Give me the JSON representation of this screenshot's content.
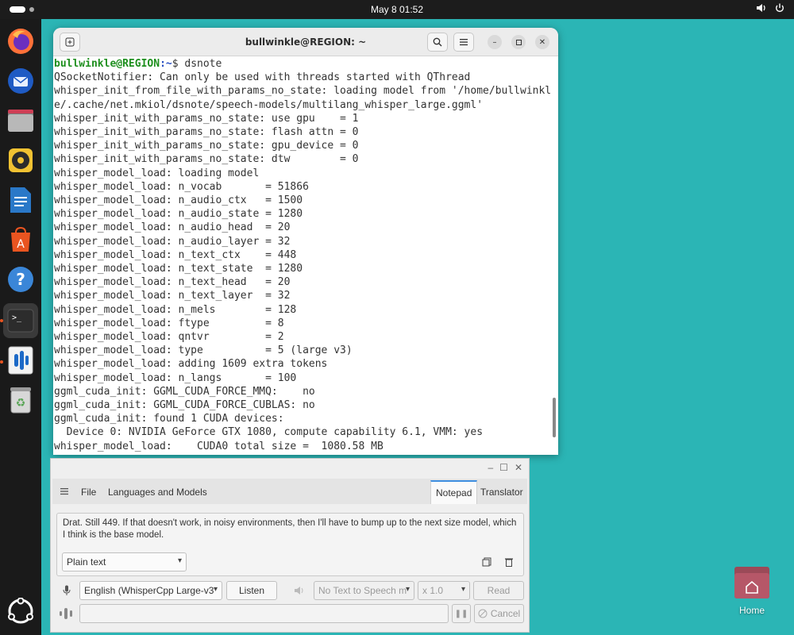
{
  "topbar": {
    "clock": "May 8  01:52"
  },
  "dock": {
    "items": [
      {
        "name": "firefox-icon",
        "color": "#ff7139"
      },
      {
        "name": "thunderbird-icon",
        "color": "#2f6fd6"
      },
      {
        "name": "files-icon",
        "color": "#cf3f56"
      },
      {
        "name": "rhythmbox-icon",
        "color": "#f1c232"
      },
      {
        "name": "libreoffice-writer-icon",
        "color": "#2a78c8"
      },
      {
        "name": "app-center-icon",
        "color": "#e95420"
      },
      {
        "name": "help-icon",
        "color": "#3a86d8"
      },
      {
        "name": "terminal-icon",
        "color": "#333333"
      },
      {
        "name": "dsnote-icon",
        "color": "#1c69c7"
      },
      {
        "name": "trash-icon",
        "color": "#59a556"
      }
    ]
  },
  "terminal": {
    "title": "bullwinkle@REGION: ~",
    "prompt_user": "bullwinkle@REGION",
    "prompt_path": ":~",
    "prompt_cmd": "$ dsnote",
    "lines": [
      "QSocketNotifier: Can only be used with threads started with QThread",
      "whisper_init_from_file_with_params_no_state: loading model from '/home/bullwinkl",
      "e/.cache/net.mkiol/dsnote/speech-models/multilang_whisper_large.ggml'",
      "whisper_init_with_params_no_state: use gpu    = 1",
      "whisper_init_with_params_no_state: flash attn = 0",
      "whisper_init_with_params_no_state: gpu_device = 0",
      "whisper_init_with_params_no_state: dtw        = 0",
      "whisper_model_load: loading model",
      "whisper_model_load: n_vocab       = 51866",
      "whisper_model_load: n_audio_ctx   = 1500",
      "whisper_model_load: n_audio_state = 1280",
      "whisper_model_load: n_audio_head  = 20",
      "whisper_model_load: n_audio_layer = 32",
      "whisper_model_load: n_text_ctx    = 448",
      "whisper_model_load: n_text_state  = 1280",
      "whisper_model_load: n_text_head   = 20",
      "whisper_model_load: n_text_layer  = 32",
      "whisper_model_load: n_mels        = 128",
      "whisper_model_load: ftype         = 8",
      "whisper_model_load: qntvr         = 2",
      "whisper_model_load: type          = 5 (large v3)",
      "whisper_model_load: adding 1609 extra tokens",
      "whisper_model_load: n_langs       = 100",
      "ggml_cuda_init: GGML_CUDA_FORCE_MMQ:    no",
      "ggml_cuda_init: GGML_CUDA_FORCE_CUBLAS: no",
      "ggml_cuda_init: found 1 CUDA devices:",
      "  Device 0: NVIDIA GeForce GTX 1080, compute capability 6.1, VMM: yes",
      "whisper_model_load:    CUDA0 total size =  1080.58 MB"
    ]
  },
  "dsnote": {
    "menu": {
      "file": "File",
      "languages_models": "Languages and Models"
    },
    "tabs": {
      "notepad": "Notepad",
      "translator": "Translator"
    },
    "note_text": "Drat. Still 449. If that doesn't work, in noisy environments, then I'll have to bump up to the next size model, which I think is the base model.",
    "text_format": "Plain text",
    "stt_model": "English (WhisperCpp Large-v3",
    "listen_label": "Listen",
    "tts_model": "No Text to Speech m",
    "speed": "x 1.0",
    "read_label": "Read",
    "cancel_label": "Cancel"
  },
  "desktop": {
    "home_label": "Home"
  }
}
